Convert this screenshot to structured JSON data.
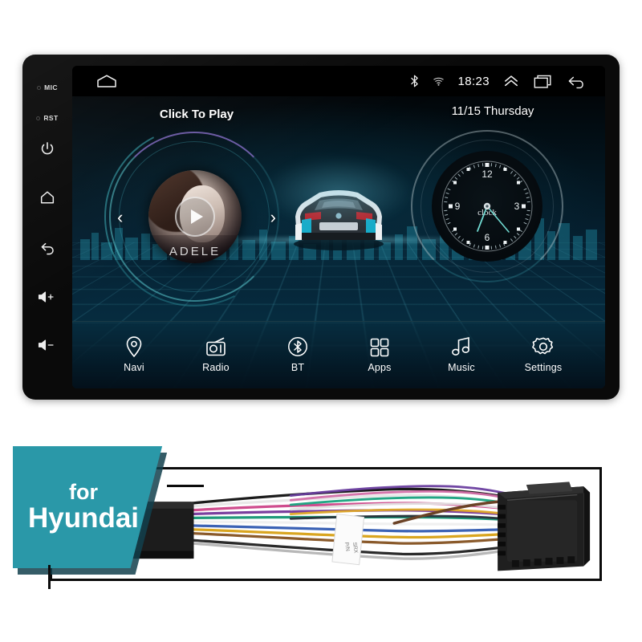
{
  "device": {
    "bezel": {
      "mic_label": "MIC",
      "rst_label": "RST",
      "buttons": [
        {
          "name": "power-button",
          "icon": "power-icon"
        },
        {
          "name": "home-button",
          "icon": "home-icon"
        },
        {
          "name": "back-button",
          "icon": "back-arrow-icon"
        },
        {
          "name": "volume-up-button",
          "icon": "volume-up-icon"
        },
        {
          "name": "volume-down-button",
          "icon": "volume-down-icon"
        }
      ]
    },
    "statusbar": {
      "home_icon": "home-icon",
      "bluetooth_icon": "bluetooth-icon",
      "signal_icon": "signal-icon",
      "time": "18:23",
      "expand_icon": "chevron-up-icon",
      "recents_icon": "recents-icon",
      "back_icon": "back-arrow-icon"
    },
    "music_widget": {
      "title": "Click To Play",
      "album_artist": "ADELE",
      "play_icon": "play-icon",
      "prev_icon": "chevron-left-icon",
      "next_icon": "chevron-right-icon",
      "prev_label": "‹",
      "next_label": "›"
    },
    "clock_widget": {
      "date": "11/15 Thursday",
      "brand_text": "clock",
      "hour_marks": [
        "12",
        "3",
        "6",
        "9"
      ]
    },
    "dock": [
      {
        "label": "Navi",
        "icon": "location-pin-icon"
      },
      {
        "label": "Radio",
        "icon": "radio-icon"
      },
      {
        "label": "BT",
        "icon": "bluetooth-icon"
      },
      {
        "label": "Apps",
        "icon": "apps-grid-icon"
      },
      {
        "label": "Music",
        "icon": "music-note-icon"
      },
      {
        "label": "Settings",
        "icon": "gear-icon"
      }
    ]
  },
  "banner": {
    "for_text": "for",
    "brand_text": "Hyundai",
    "color": "#2a98a8"
  },
  "harness": {
    "alt": "wiring-harness-photo",
    "label_tag": "cable-label-tag"
  }
}
